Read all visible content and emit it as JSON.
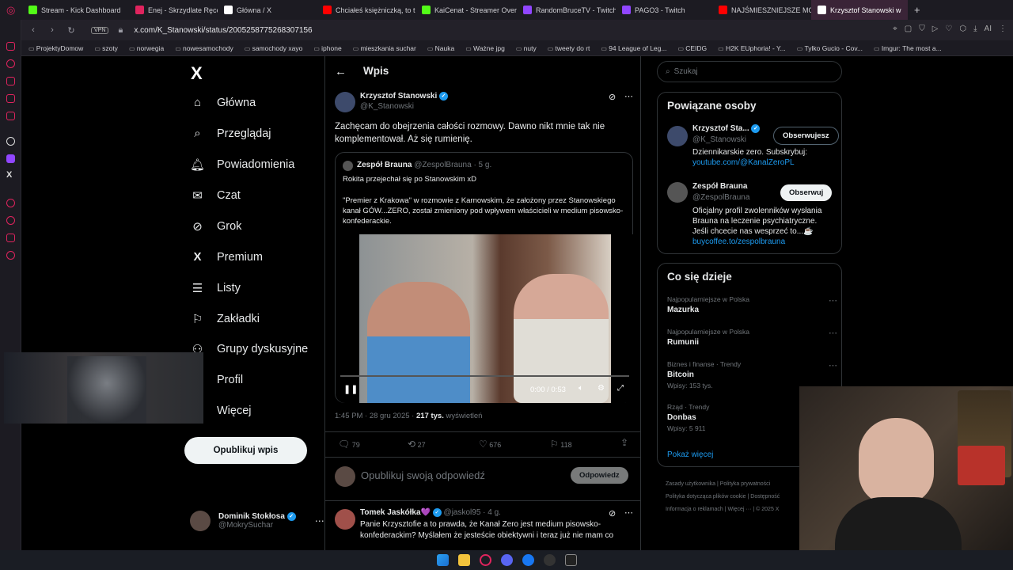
{
  "tabs": [
    {
      "label": "Stream - Kick Dashboard",
      "color": "#53fc18"
    },
    {
      "label": "Enej - Skrzydlate Ręce (M",
      "color": "#e0245e"
    },
    {
      "label": "Główna / X",
      "color": "#ffffff"
    },
    {
      "label": "Chciałeś księżniczką, to t",
      "color": "#ff0000"
    },
    {
      "label": "KaiCenat - Streamer Over",
      "color": "#53fc18"
    },
    {
      "label": "RandomBruceTV - Twitch",
      "color": "#9146ff"
    },
    {
      "label": "PAGO3 - Twitch",
      "color": "#9146ff"
    },
    {
      "label": "NAJŚMIESZNIEJSZE MO",
      "color": "#ff0000"
    },
    {
      "label": "Krzysztof Stanowski w",
      "color": "#ffffff"
    }
  ],
  "address": {
    "vpn": "VPN",
    "url": "x.com/K_Stanowski/status/2005258775268307156"
  },
  "bookmarks": [
    "ProjektyDomow",
    "szoty",
    "norwegia",
    "nowesamochody",
    "samochody xayo",
    "iphone",
    "mieszkania suchar",
    "Nauka",
    "Ważne jpg",
    "nuty",
    "tweety do rt",
    "94 League of Leg...",
    "CEIDG",
    "H2K EUphoria! - Y...",
    "Tylko Gucio - Cov...",
    "Imgur: The most a..."
  ],
  "nav": {
    "logo": "X",
    "items": [
      {
        "label": "Główna",
        "icon": "home-icon",
        "glyph": "⌂"
      },
      {
        "label": "Przeglądaj",
        "icon": "search-icon",
        "glyph": "⌕"
      },
      {
        "label": "Powiadomienia",
        "icon": "bell-icon",
        "glyph": "♫"
      },
      {
        "label": "Czat",
        "icon": "mail-icon",
        "glyph": "✉"
      },
      {
        "label": "Grok",
        "icon": "grok-icon",
        "glyph": "⊘"
      },
      {
        "label": "Premium",
        "icon": "x-icon",
        "glyph": "X"
      },
      {
        "label": "Listy",
        "icon": "list-icon",
        "glyph": "☰"
      },
      {
        "label": "Zakładki",
        "icon": "bookmark-icon",
        "glyph": "⚑"
      },
      {
        "label": "Grupy dyskusyjne",
        "icon": "people-icon",
        "glyph": "⚇"
      },
      {
        "label": "Profil",
        "icon": "profile-icon",
        "glyph": "☺"
      },
      {
        "label": "Więcej",
        "icon": "more-icon",
        "glyph": "⋯"
      }
    ],
    "post_button": "Opublikuj wpis",
    "account": {
      "name": "Dominik Stokłosa",
      "handle": "@MokrySuchar"
    }
  },
  "post": {
    "header": "Wpis",
    "author": "Krzysztof Stanowski",
    "handle": "@K_Stanowski",
    "text": "Zachęcam do obejrzenia całości rozmowy. Dawno nikt mnie tak nie komplementował. Aż się rumienię.",
    "quote": {
      "author": "Zespół Brauna",
      "handle": "@ZespolBrauna",
      "age": "· 5 g.",
      "line1": "Rokita przejechał się po Stanowskim xD",
      "line2": "\"Premier z Krakowa\" w rozmowie z Karnowskim, że założony przez Stanowskiego kanał GÓW...ZERO, został zmieniony pod wpływem właścicieli w medium pisowsko-konfederackie.",
      "video_time": "0:00 / 0:53"
    },
    "meta_time": "1:45 PM · 28 gru 2025 ·",
    "views": "217 tys.",
    "views_label": "wyświetleń",
    "stats": {
      "replies": "79",
      "reposts": "27",
      "likes": "676",
      "bookmarks": "118"
    },
    "reply_placeholder": "Opublikuj swoją odpowiedź",
    "reply_button": "Odpowiedz",
    "comment": {
      "author": "Tomek Jaskółka💜",
      "handle": "@jaskol95",
      "age": "· 4 g.",
      "text": "Panie Krzysztofie a to prawda, że Kanał Zero jest medium pisowsko-konfederackim? Myślałem że jesteście obiektywni i teraz już nie mam co"
    }
  },
  "search": {
    "placeholder": "Szukaj"
  },
  "related": {
    "title": "Powiązane osoby",
    "people": [
      {
        "name": "Krzysztof Sta...",
        "handle": "@K_Stanowski",
        "bio": "Dziennikarskie zero. Subskrybuj:",
        "link": "youtube.com/@KanalZeroPL",
        "button": "Obserwujesz"
      },
      {
        "name": "Zespół Brauna",
        "handle": "@ZespolBrauna",
        "bio": "Oficjalny profil zwolenników wysłania Brauna na leczenie psychiatryczne. Jeśli chcecie nas wesprzeć to...☕",
        "link": "buycoffee.to/zespolbrauna",
        "button": "Obserwuj"
      }
    ]
  },
  "trends": {
    "title": "Co się dzieje",
    "items": [
      {
        "context": "Najpopularniejsze w Polska",
        "name": "Mazurka",
        "count": ""
      },
      {
        "context": "Najpopularniejsze w Polska",
        "name": "Rumunii",
        "count": ""
      },
      {
        "context": "Biznes i finanse · Trendy",
        "name": "Bitcoin",
        "count": "Wpisy: 153 tys."
      },
      {
        "context": "Rząd · Trendy",
        "name": "Donbas",
        "count": "Wpisy: 5 911"
      }
    ],
    "show_more": "Pokaż więcej"
  },
  "footer": [
    "Zasady użytkownika",
    "Polityka prywatności",
    "Polityka dotycząca plików cookie",
    "Dostępność",
    "Informacja o reklamach",
    "Więcej ···",
    "© 2025 X"
  ]
}
